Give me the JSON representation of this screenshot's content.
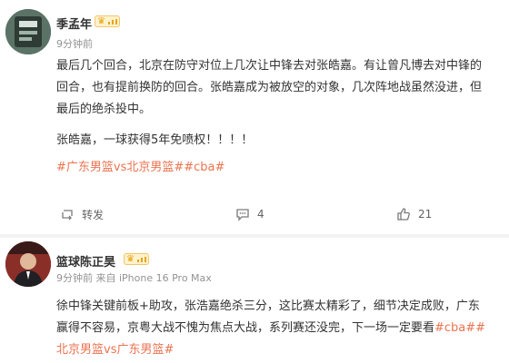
{
  "post1": {
    "username": "季孟年",
    "time": "9分钟前",
    "lines": [
      "最后几个回合，北京在防守对位上几次让中锋去对张皓嘉。有让曾凡博去对中锋的",
      "回合，也有提前换防的回合。张皓嘉成为被放空的对象，几次阵地战虽然没进，但",
      "最后的绝杀投中。",
      "张皓嘉，一球获得5年免喷权！！！！"
    ],
    "hashtags": "#广东男篮vs北京男篮##cba#",
    "actions": {
      "repost_label": "转发",
      "comment_count": "4",
      "like_count": "21"
    }
  },
  "post2": {
    "username": "篮球陈正昊",
    "meta": "9分钟前 来自 iPhone 16 Pro Max",
    "lines": [
      "徐中锋关键前板+助攻，张浩嘉绝杀三分，这比赛太精彩了，细节决定成败，广东",
      "赢得不容易，京粤大战不愧为焦点大战，系列赛还没完，下一场一定要看"
    ],
    "line2_hashtag": "#cba##",
    "line3_hashtag": "北京男篮vs广东男篮#"
  },
  "colors": {
    "hashtag": "#eb7350",
    "meta": "#939393",
    "text": "#333333",
    "badge": "#e8a317"
  },
  "icons": [
    "repost-icon",
    "comment-icon",
    "like-icon",
    "crown-icon",
    "level-bars-icon"
  ]
}
